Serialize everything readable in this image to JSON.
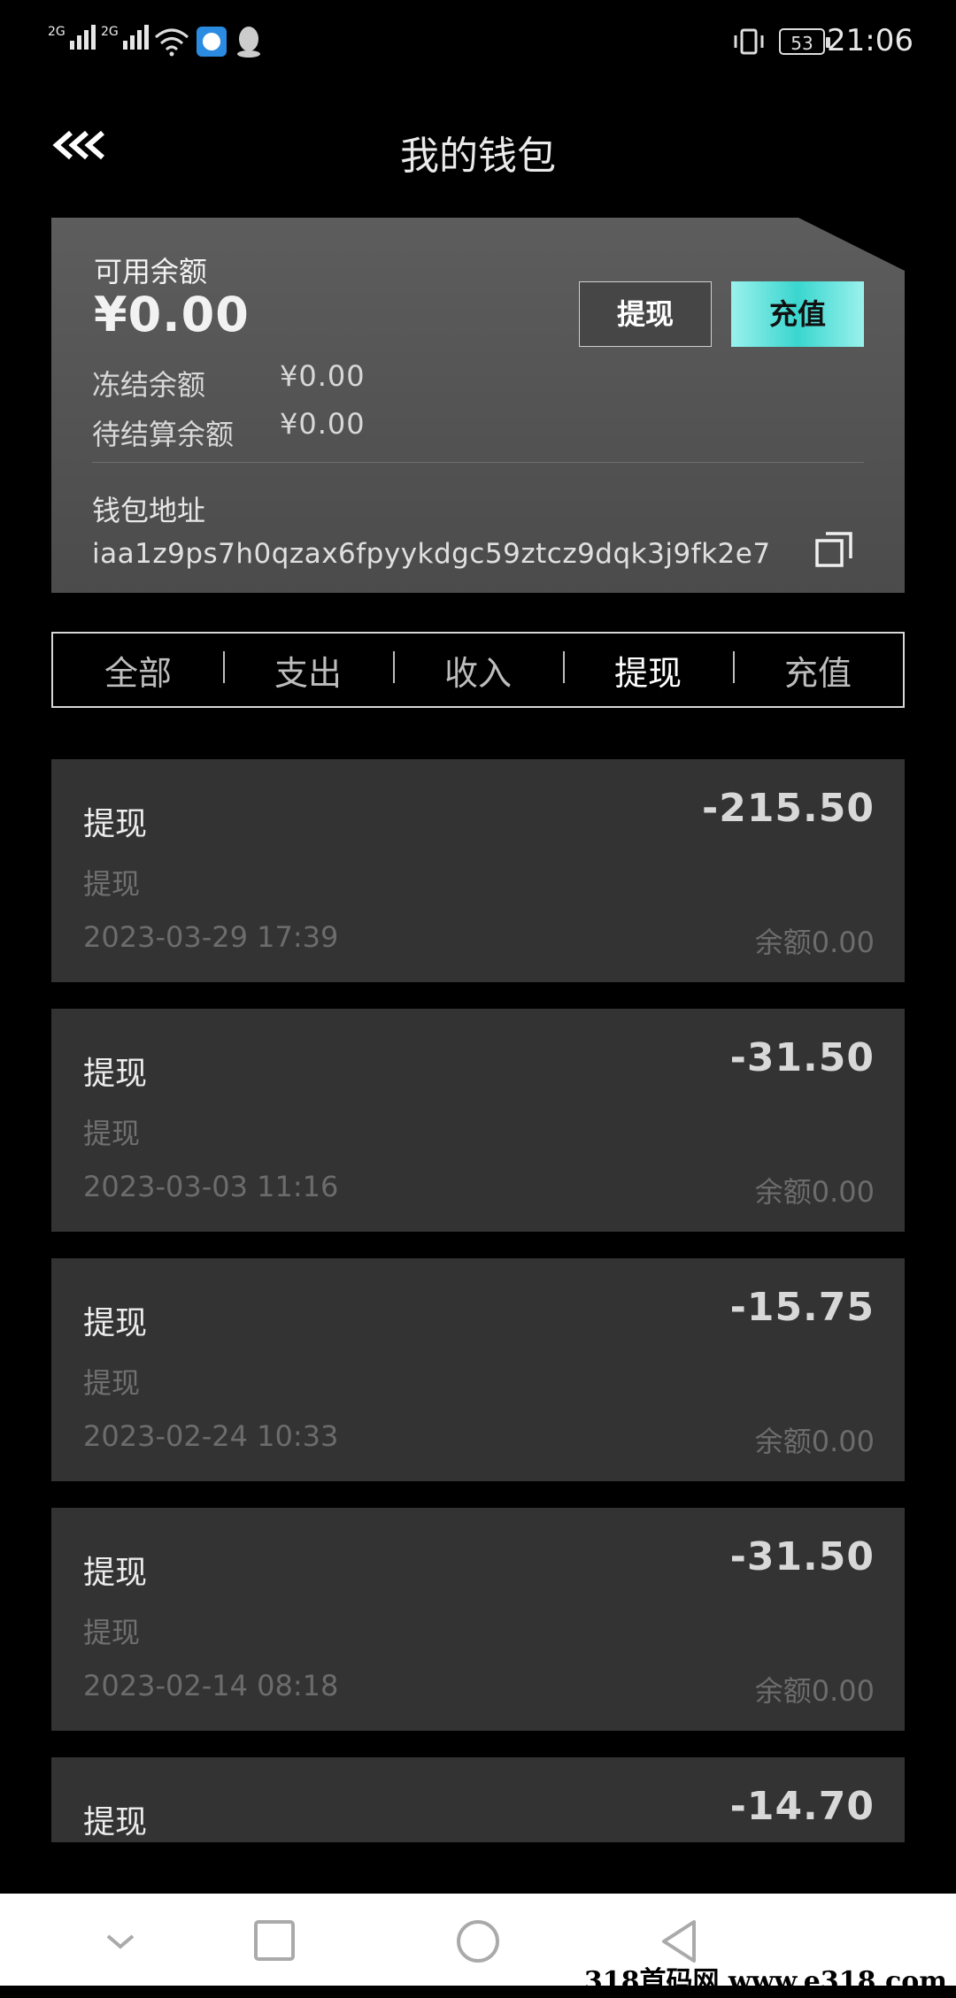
{
  "status_bar": {
    "network1": "2G",
    "network2": "2G",
    "battery": "53",
    "time": "21:06"
  },
  "header": {
    "title": "我的钱包"
  },
  "wallet": {
    "available_label": "可用余额",
    "available_amount": "¥0.00",
    "frozen_label": "冻结余额",
    "frozen_value": "¥0.00",
    "pending_label": "待结算余额",
    "pending_value": "¥0.00",
    "withdraw_label": "提现",
    "recharge_label": "充值",
    "address_label": "钱包地址",
    "address_value": "iaa1z9ps7h0qzax6fpyykdgc59ztcz9dqk3j9fk2e7"
  },
  "tabs": [
    {
      "label": "全部",
      "active": false
    },
    {
      "label": "支出",
      "active": false
    },
    {
      "label": "收入",
      "active": false
    },
    {
      "label": "提现",
      "active": true
    },
    {
      "label": "充值",
      "active": false
    }
  ],
  "transactions": [
    {
      "title": "提现",
      "subtitle": "提现",
      "date": "2023-03-29 17:39",
      "amount": "-215.50",
      "balance": "余额0.00"
    },
    {
      "title": "提现",
      "subtitle": "提现",
      "date": "2023-03-03 11:16",
      "amount": "-31.50",
      "balance": "余额0.00"
    },
    {
      "title": "提现",
      "subtitle": "提现",
      "date": "2023-02-24 10:33",
      "amount": "-15.75",
      "balance": "余额0.00"
    },
    {
      "title": "提现",
      "subtitle": "提现",
      "date": "2023-02-14 08:18",
      "amount": "-31.50",
      "balance": "余额0.00"
    },
    {
      "title": "提现",
      "subtitle": "",
      "date": "",
      "amount": "-14.70",
      "balance": ""
    }
  ],
  "watermark": "318首码网 www.e318.com",
  "colors": {
    "background": "#000000",
    "card": "#555555",
    "recharge_accent": "#3ad6cf",
    "list_item": "#333333"
  }
}
